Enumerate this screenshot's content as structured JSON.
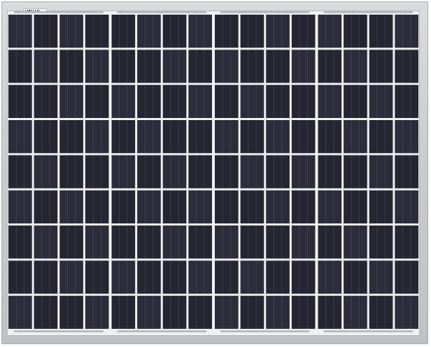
{
  "image": {
    "subject": "solar-panel",
    "orientation": "landscape"
  },
  "panel": {
    "string_columns": 4,
    "cell_columns_per_string": 4,
    "cell_rows": 9,
    "frame_color": "#c9cbce",
    "cell_color": "#262532",
    "cell_color_alt": "#2d2c3b",
    "grid_line_color": "#e8e9ec",
    "busbar_color": "#6a6a78"
  },
  "label": {
    "type": "barcode-sticker",
    "text_visible": false
  }
}
